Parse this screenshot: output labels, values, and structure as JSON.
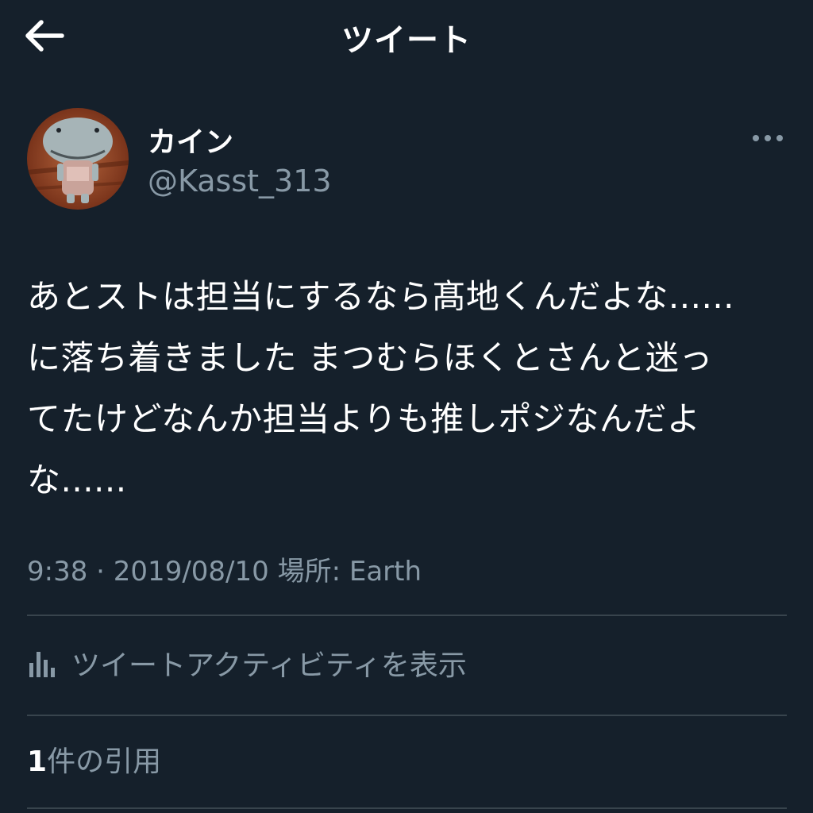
{
  "header": {
    "title": "ツイート",
    "back_icon": "arrow-left-icon"
  },
  "tweet": {
    "author": {
      "display_name": "カイン",
      "handle": "@Kasst_313"
    },
    "text": "あとストは担当にするなら髙地くんだよな......\nに落ち着きました まつむらほくとさんと迷っ\nてたけどなんか担当よりも推しポジなんだよ\nな......",
    "time": "9:38",
    "separator": "·",
    "date": "2019/08/10",
    "location_label": "場所: Earth"
  },
  "activity": {
    "label": "ツイートアクティビティを表示",
    "icon": "analytics-bar-chart-icon"
  },
  "quotes": {
    "count": "1",
    "label": "件の引用"
  },
  "colors": {
    "background": "#15202b",
    "primary_text": "#ffffff",
    "secondary_text": "#8899a6",
    "divider": "#38444d"
  }
}
